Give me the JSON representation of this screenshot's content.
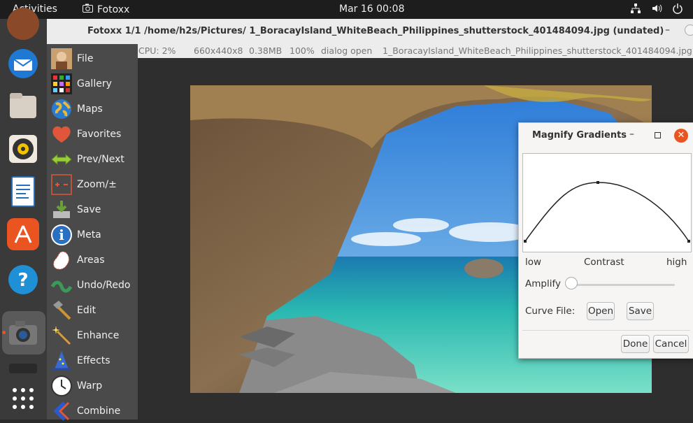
{
  "topbar": {
    "activities": "Activities",
    "app_name": "Fotoxx",
    "clock": "Mar 16  00:08"
  },
  "window": {
    "title": "Fotoxx   1/1  /home/h2s/Pictures/  1_BoracayIsland_WhiteBeach_Philippines_shutterstock_401484094.jpg  (undated)",
    "minimize": "–"
  },
  "status": {
    "cpu": "CPU: 2%",
    "dims": "660x440x8",
    "size": "0.38MB",
    "zoom": "100%",
    "mode": "dialog open",
    "file": "1_BoracayIsland_WhiteBeach_Philippines_shutterstock_401484094.jpg"
  },
  "sidebar": {
    "items": [
      {
        "label": "File",
        "icon": "file-portrait-icon"
      },
      {
        "label": "Gallery",
        "icon": "gallery-icon"
      },
      {
        "label": "Maps",
        "icon": "globe-icon"
      },
      {
        "label": "Favorites",
        "icon": "heart-icon"
      },
      {
        "label": "Prev/Next",
        "icon": "arrows-icon"
      },
      {
        "label": "Zoom/±",
        "icon": "zoom-icon"
      },
      {
        "label": "Save",
        "icon": "save-icon"
      },
      {
        "label": "Meta",
        "icon": "info-icon"
      },
      {
        "label": "Areas",
        "icon": "areas-icon"
      },
      {
        "label": "Undo/Redo",
        "icon": "undo-redo-icon"
      },
      {
        "label": "Edit",
        "icon": "hammer-icon"
      },
      {
        "label": "Enhance",
        "icon": "wand-icon"
      },
      {
        "label": "Effects",
        "icon": "wizard-hat-icon"
      },
      {
        "label": "Warp",
        "icon": "clock-icon"
      },
      {
        "label": "Combine",
        "icon": "combine-icon"
      }
    ]
  },
  "dialog": {
    "title": "Magnify Gradients",
    "minimize": "–",
    "close": "✕",
    "label_low": "low",
    "label_contrast": "Contrast",
    "label_high": "high",
    "amplify_label": "Amplify",
    "amplify_value": 0,
    "curve_file_label": "Curve File:",
    "open_button": "Open",
    "save_button": "Save",
    "done_button": "Done",
    "cancel_button": "Cancel"
  },
  "colors": {
    "accent": "#e95420",
    "sidebar_bg": "#4a4a4a",
    "dock_bg": "#3a3a3a"
  }
}
